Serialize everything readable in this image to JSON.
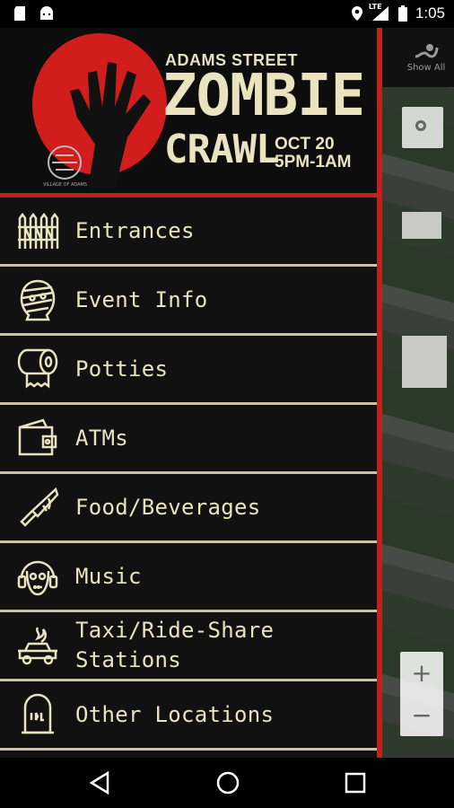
{
  "status_bar": {
    "time": "1:05",
    "network": "LTE"
  },
  "map": {
    "show_all_label": "Show All",
    "zoom_in": "+",
    "zoom_out": "−"
  },
  "banner": {
    "top_line": "ADAMS STREET",
    "title_1": "ZOMBIE",
    "title_2": "CRAWL",
    "date": "OCT 20",
    "time": "5PM-1AM",
    "logo_text": "VILLAGE OF ADAMS"
  },
  "menu": {
    "items": [
      {
        "label": "Entrances",
        "icon": "fence-icon"
      },
      {
        "label": "Event Info",
        "icon": "mummy-icon"
      },
      {
        "label": "Potties",
        "icon": "toilet-paper-icon"
      },
      {
        "label": "ATMs",
        "icon": "wallet-icon"
      },
      {
        "label": "Food/Beverages",
        "icon": "knife-icon"
      },
      {
        "label": "Music",
        "icon": "zombie-headphones-icon"
      },
      {
        "label": "Taxi/Ride-Share Stations",
        "icon": "burning-car-icon"
      },
      {
        "label": "Other Locations",
        "icon": "tombstone-icon"
      }
    ]
  },
  "colors": {
    "accent": "#c0211d",
    "text": "#e9e3c0",
    "background": "#111111"
  }
}
